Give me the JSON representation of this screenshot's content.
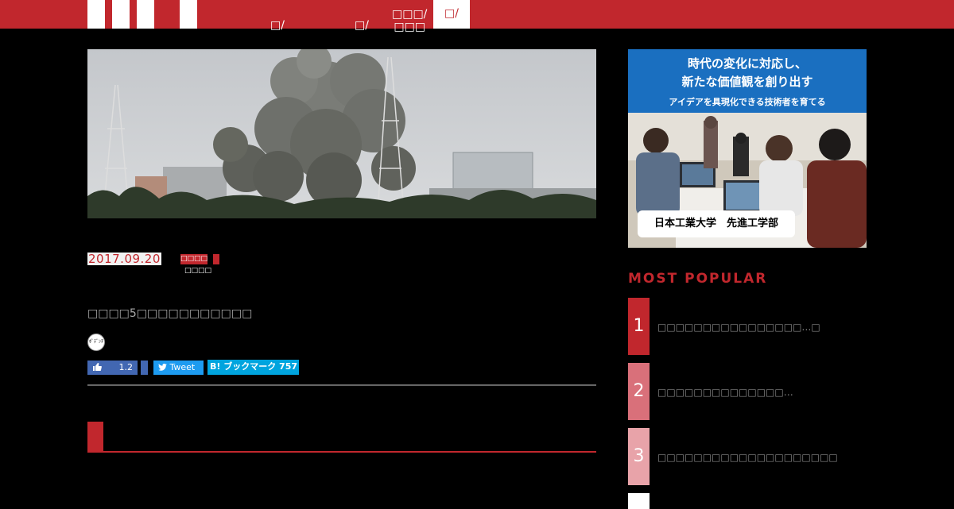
{
  "nav": {
    "items": [
      {
        "label": "□/"
      },
      {
        "label": "□/"
      },
      {
        "label": "□□□/\n□□□"
      }
    ],
    "active_label": "□/"
  },
  "article": {
    "date": "2017.09.20",
    "category": "□□□□",
    "author": "□□□□",
    "title": "□□□□5□□□□□□□□□□□",
    "avatar_text": "ﾎﾟﾃﾞﾝﾁｬ"
  },
  "share": {
    "like_count": "1.2",
    "tweet_label": "Tweet",
    "hatena_label": "B! ブックマーク 757"
  },
  "sidebar": {
    "ad": {
      "line1": "時代の変化に対応し、",
      "line2": "新たな価値観を創り出す",
      "line3": "アイデアを具現化できる技術者を育てる",
      "caption": "日本工業大学　先進工学部"
    },
    "popular_heading": "MOST POPULAR",
    "ranking": [
      {
        "num": "1",
        "text": "□□□□□□□□□□□□□□□□…□",
        "color": "#c1272d"
      },
      {
        "num": "2",
        "text": "□□□□□□□□□□□□□□…",
        "color": "#d9707a"
      },
      {
        "num": "3",
        "text": "□□□□□□□□□□□□□□□□□□□□",
        "color": "#e8a3a9"
      }
    ]
  },
  "colors": {
    "brand": "#c1272d",
    "background": "#000000"
  }
}
